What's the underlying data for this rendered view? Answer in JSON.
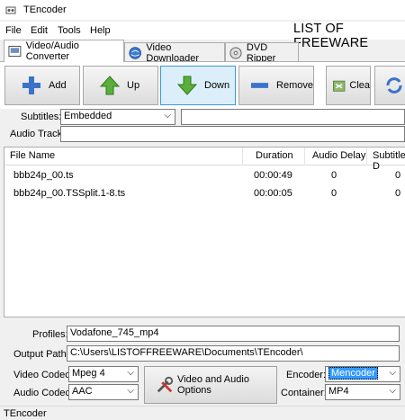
{
  "window": {
    "title": "TEncoder"
  },
  "menu": [
    "File",
    "Edit",
    "Tools",
    "Help"
  ],
  "brand": "LIST OF FREEWARE",
  "tabs": [
    {
      "label": "Video/Audio Converter",
      "icon": "converter-icon"
    },
    {
      "label": "Video Downloader",
      "icon": "globe-download-icon"
    },
    {
      "label": "DVD Ripper",
      "icon": "dvd-icon"
    }
  ],
  "toolbar": {
    "add": "Add",
    "up": "Up",
    "down": "Down",
    "remove": "Remove",
    "clear": "Clea"
  },
  "subtitles": {
    "label": "Subtitles:",
    "value": "Embedded",
    "extra": ""
  },
  "audio_track": {
    "label": "Audio Track:",
    "value": ""
  },
  "table": {
    "columns": [
      "File Name",
      "Duration",
      "Audio Delay",
      "Subtitle D"
    ],
    "rows": [
      {
        "name": "bbb24p_00.ts",
        "duration": "00:00:49",
        "audio_delay": "0",
        "subtitle_delay": "0"
      },
      {
        "name": "bbb24p_00.TSSplit.1-8.ts",
        "duration": "00:00:05",
        "audio_delay": "0",
        "subtitle_delay": "0"
      }
    ]
  },
  "profiles": {
    "label": "Profiles:",
    "value": "Vodafone_745_mp4"
  },
  "output_path": {
    "label": "Output Path:",
    "value": "C:\\Users\\LISTOFFREEWARE\\Documents\\TEncoder\\"
  },
  "video_codec": {
    "label": "Video Codec:",
    "value": "Mpeg 4"
  },
  "audio_codec": {
    "label": "Audio Codec:",
    "value": "AAC"
  },
  "options_button": "Video and Audio Options",
  "encoder": {
    "label": "Encoder:",
    "value": "Mencoder"
  },
  "container": {
    "label": "Container:",
    "value": "MP4"
  },
  "status": "TEncoder",
  "colors": {
    "selection": "#3399ff",
    "active_button": "#dbeefa",
    "window": "#f0f0f0"
  }
}
